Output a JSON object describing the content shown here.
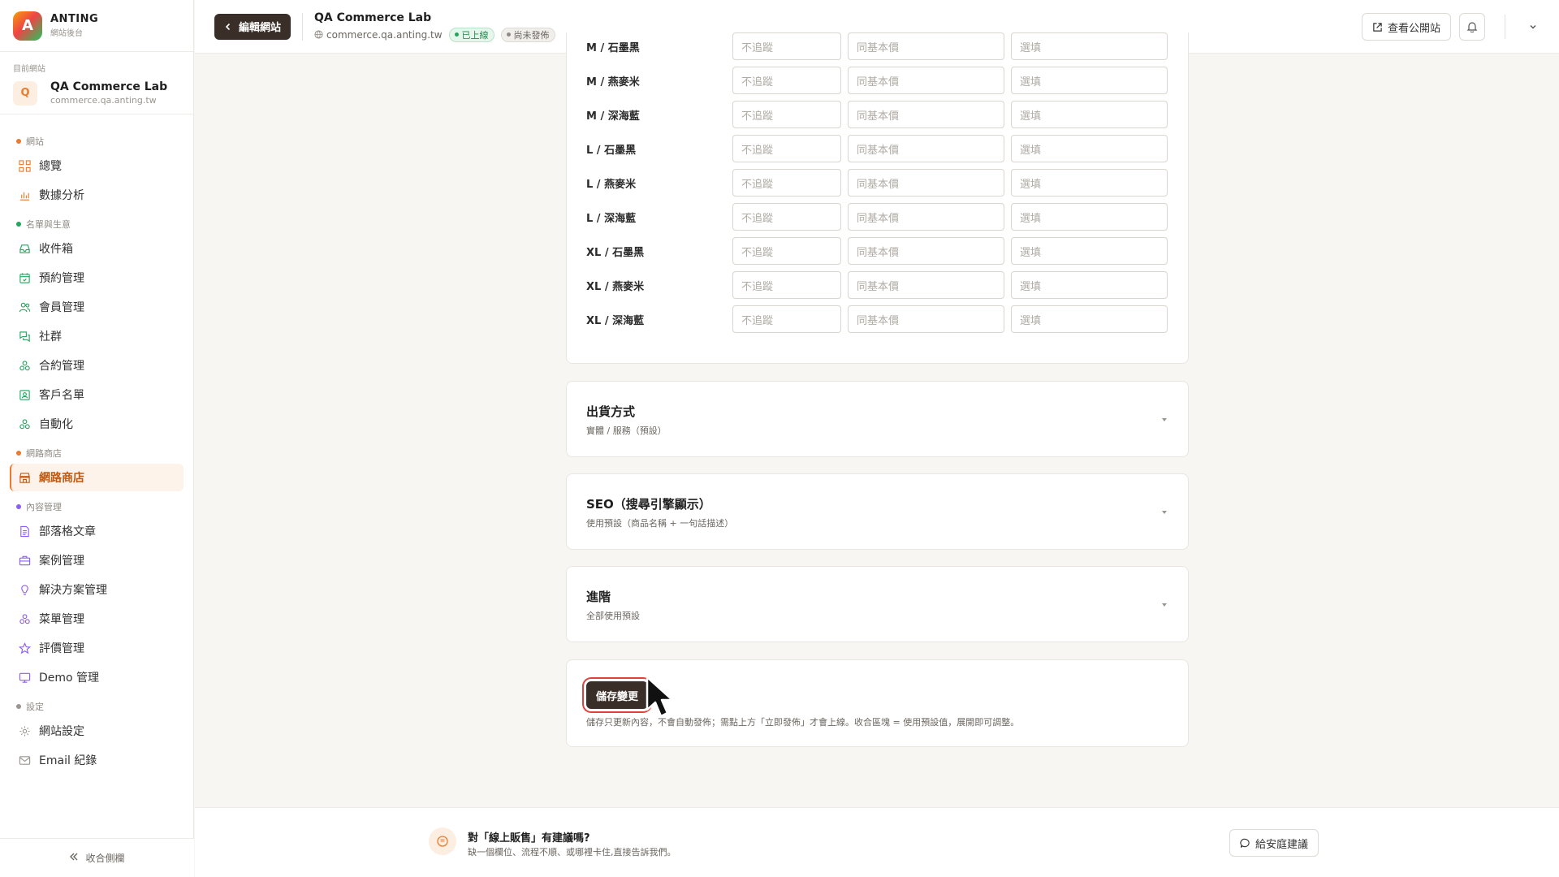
{
  "brand": {
    "logo_letter": "A",
    "name": "ANTING",
    "subtitle": "網站後台"
  },
  "site": {
    "label": "目前網站",
    "avatar_letter": "Q",
    "name": "QA Commerce Lab",
    "domain": "commerce.qa.anting.tw"
  },
  "sidebar": {
    "sections": [
      {
        "label": "網站",
        "color": "#ea7a2c",
        "items": [
          {
            "label": "總覽",
            "icon": "grid-icon"
          },
          {
            "label": "數據分析",
            "icon": "bar-chart-icon"
          }
        ]
      },
      {
        "label": "名單與生意",
        "color": "#22a55e",
        "items": [
          {
            "label": "收件箱",
            "icon": "inbox-icon"
          },
          {
            "label": "預約管理",
            "icon": "calendar-icon"
          },
          {
            "label": "會員管理",
            "icon": "users-icon"
          },
          {
            "label": "社群",
            "icon": "chat-icon"
          },
          {
            "label": "合約管理",
            "icon": "cluster-icon"
          },
          {
            "label": "客戶名單",
            "icon": "contact-icon"
          },
          {
            "label": "自動化",
            "icon": "automation-icon"
          }
        ]
      },
      {
        "label": "網路商店",
        "color": "#ea7a2c",
        "items": [
          {
            "label": "網路商店",
            "icon": "store-icon",
            "active": true
          }
        ]
      },
      {
        "label": "內容管理",
        "color": "#8b5cf6",
        "items": [
          {
            "label": "部落格文章",
            "icon": "document-icon"
          },
          {
            "label": "案例管理",
            "icon": "briefcase-icon"
          },
          {
            "label": "解決方案管理",
            "icon": "lightbulb-icon"
          },
          {
            "label": "菜單管理",
            "icon": "cluster-icon"
          },
          {
            "label": "評價管理",
            "icon": "star-icon"
          },
          {
            "label": "Demo 管理",
            "icon": "monitor-icon"
          }
        ]
      },
      {
        "label": "設定",
        "color": "#9a958e",
        "items": [
          {
            "label": "網站設定",
            "icon": "gear-icon"
          },
          {
            "label": "Email 紀錄",
            "icon": "mail-icon"
          }
        ]
      }
    ],
    "collapse_label": "收合側欄"
  },
  "topbar": {
    "back_label": "編輯網站",
    "title": "QA Commerce Lab",
    "domain": "commerce.qa.anting.tw",
    "badge_live": "已上線",
    "badge_draft": "尚未發佈",
    "public_label": "查看公開站"
  },
  "variants": {
    "placeholders": {
      "sku": "不追蹤",
      "price": "同基本價",
      "note": "選填"
    },
    "rows": [
      "M / 石墨黑",
      "M / 燕麥米",
      "M / 深海藍",
      "L / 石墨黑",
      "L / 燕麥米",
      "L / 深海藍",
      "XL / 石墨黑",
      "XL / 燕麥米",
      "XL / 深海藍"
    ]
  },
  "sections": [
    {
      "title": "出貨方式",
      "subtitle": "實體 / 服務（預設）"
    },
    {
      "title": "SEO（搜尋引擎顯示）",
      "subtitle": "使用預設（商品名稱 + 一句話描述）"
    },
    {
      "title": "進階",
      "subtitle": "全部使用預設"
    }
  ],
  "save": {
    "button_label": "儲存變更",
    "note": "儲存只更新內容，不會自動發佈；需點上方「立即發佈」才會上線。收合區塊 = 使用預設值，展開即可調整。"
  },
  "feedback": {
    "title": "對「線上販售」有建議嗎?",
    "subtitle": "缺一個欄位、流程不順、或哪裡卡住,直接告訴我們。",
    "button_label": "給安庭建議"
  }
}
